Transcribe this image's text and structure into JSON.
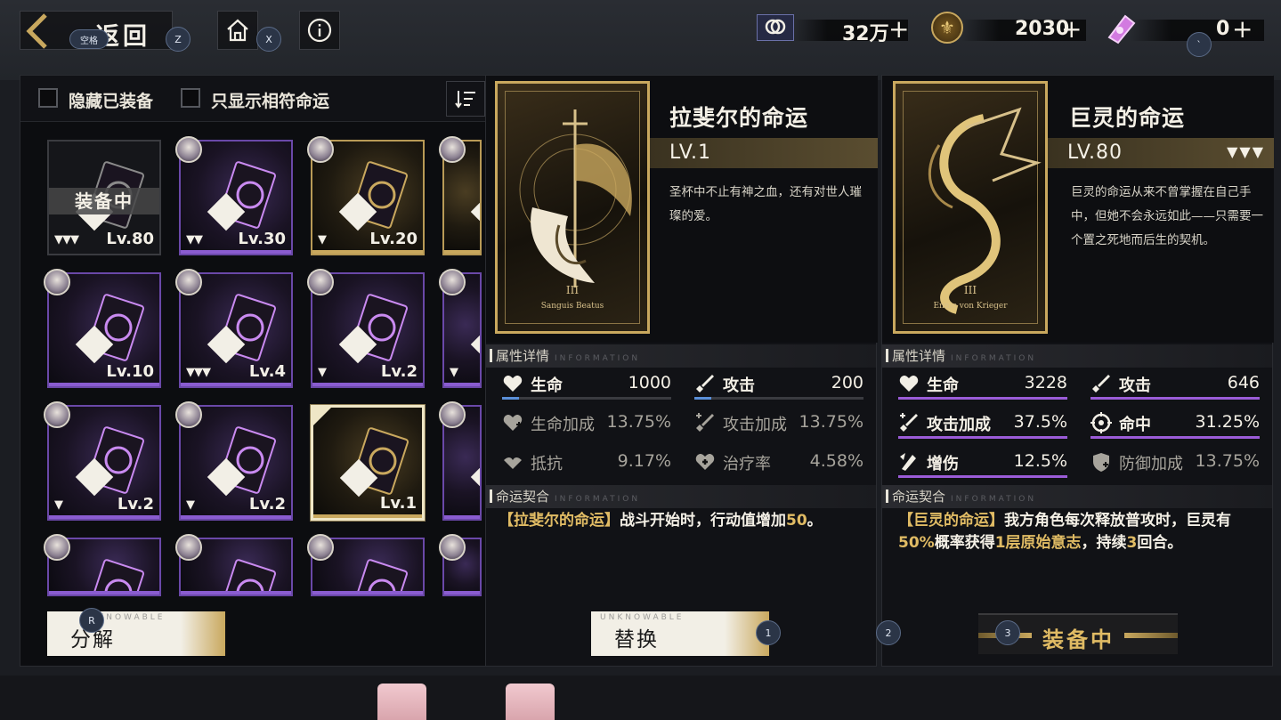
{
  "topbar": {
    "back_label": "返回",
    "hints": {
      "back": "空格",
      "home": "Z",
      "info": "X",
      "currency3": "`"
    },
    "currencies": [
      {
        "icon": "ticket-icon",
        "value": "32万"
      },
      {
        "icon": "fleur-coin-icon",
        "value": "2030"
      },
      {
        "icon": "crystal-icon",
        "value": "0"
      }
    ],
    "plus": "+"
  },
  "filters": {
    "hide_equipped": "隐藏已装备",
    "show_matching": "只显示相符命运"
  },
  "inventory": {
    "equipped_banner": "装备中",
    "cards": [
      {
        "level": "Lv.80",
        "rank": "▼▼▼",
        "style": "plain",
        "avatar": false,
        "equipped": true
      },
      {
        "level": "Lv.30",
        "rank": "▼▼",
        "style": "purple",
        "avatar": true
      },
      {
        "level": "Lv.20",
        "rank": "▼",
        "style": "gold",
        "avatar": true
      },
      {
        "level": "",
        "rank": "",
        "style": "gold",
        "avatar": true
      },
      {
        "level": "Lv.10",
        "rank": "",
        "style": "purple",
        "avatar": true
      },
      {
        "level": "Lv.4",
        "rank": "▼▼▼",
        "style": "purple",
        "avatar": true
      },
      {
        "level": "Lv.2",
        "rank": "▼",
        "style": "purple",
        "avatar": true
      },
      {
        "level": "",
        "rank": "▼",
        "style": "purple",
        "avatar": true
      },
      {
        "level": "Lv.2",
        "rank": "▼",
        "style": "purple",
        "avatar": true
      },
      {
        "level": "Lv.2",
        "rank": "▼",
        "style": "purple",
        "avatar": true
      },
      {
        "level": "Lv.1",
        "rank": "",
        "style": "gold",
        "avatar": false,
        "selected": true
      },
      {
        "level": "",
        "rank": "",
        "style": "purple",
        "avatar": true
      },
      {
        "level": "",
        "rank": "",
        "style": "purple",
        "avatar": true
      },
      {
        "level": "",
        "rank": "",
        "style": "purple",
        "avatar": true
      },
      {
        "level": "",
        "rank": "",
        "style": "purple",
        "avatar": true
      },
      {
        "level": "",
        "rank": "",
        "style": "purple",
        "avatar": true
      }
    ],
    "decompose_label": "分解",
    "decompose_hint": "R",
    "unknowable": "UNKNOWABLE"
  },
  "left_detail": {
    "name": "拉斐尔的命运",
    "level": "LV.1",
    "rank": "",
    "numeral": "III",
    "card_caption": "Sanguis Beatus",
    "description": "圣杯中不止有神之血，还有对世人璀璨的爱。",
    "attr_title": "属性详情",
    "fate_title": "命运契合",
    "en_label": "INFORMATION",
    "stats": [
      {
        "icon": "heart-icon",
        "name": "生命",
        "value": "1000",
        "fill": 0.1,
        "dim": false
      },
      {
        "icon": "sword-icon",
        "name": "攻击",
        "value": "200",
        "fill": 0.1,
        "dim": false
      },
      {
        "icon": "heart-plus-icon",
        "name": "生命加成",
        "value": "13.75%",
        "dim": true
      },
      {
        "icon": "sword-plus-icon",
        "name": "攻击加成",
        "value": "13.75%",
        "dim": true
      },
      {
        "icon": "resist-icon",
        "name": "抵抗",
        "value": "9.17%",
        "dim": true
      },
      {
        "icon": "heal-icon",
        "name": "治疗率",
        "value": "4.58%",
        "dim": true
      }
    ],
    "effect": {
      "p1": "【拉斐尔的命运】",
      "p2": "战斗开始时，行动值增加",
      "p3": "50",
      "p4": "。"
    },
    "replace_label": "替换",
    "replace_hint": "1"
  },
  "right_detail": {
    "name": "巨灵的命运",
    "level": "LV.80",
    "rank": "▼▼▼",
    "numeral": "III",
    "card_caption": "Ennio von Krieger",
    "description": "巨灵的命运从来不曾掌握在自己手中，但她不会永远如此——只需要一个置之死地而后生的契机。",
    "attr_title": "属性详情",
    "fate_title": "命运契合",
    "en_label": "INFORMATION",
    "stats": [
      {
        "icon": "heart-icon",
        "name": "生命",
        "value": "3228",
        "dim": false,
        "hl": true
      },
      {
        "icon": "sword-icon",
        "name": "攻击",
        "value": "646",
        "dim": false,
        "hl": true
      },
      {
        "icon": "sword-plus-icon",
        "name": "攻击加成",
        "value": "37.5%",
        "dim": false,
        "hl": true
      },
      {
        "icon": "target-icon",
        "name": "命中",
        "value": "31.25%",
        "dim": false,
        "hl": true
      },
      {
        "icon": "damage-icon",
        "name": "增伤",
        "value": "12.5%",
        "dim": false,
        "hl": true
      },
      {
        "icon": "defense-plus-icon",
        "name": "防御加成",
        "value": "13.75%",
        "dim": true
      }
    ],
    "effect": {
      "p1": "【巨灵的命运】",
      "p2": "我方角色每次释放普攻时，巨灵有",
      "p3": "50%",
      "p4": "概率获得",
      "p5": "1层原始意志",
      "p6": "，持续",
      "p7": "3",
      "p8": "回合。"
    },
    "equipped_label": "装备中",
    "hint2": "2",
    "hint3": "3"
  },
  "colors": {
    "gold": "#c9a85e",
    "purple": "#8a5cd0",
    "blue": "#5a8fd8"
  }
}
